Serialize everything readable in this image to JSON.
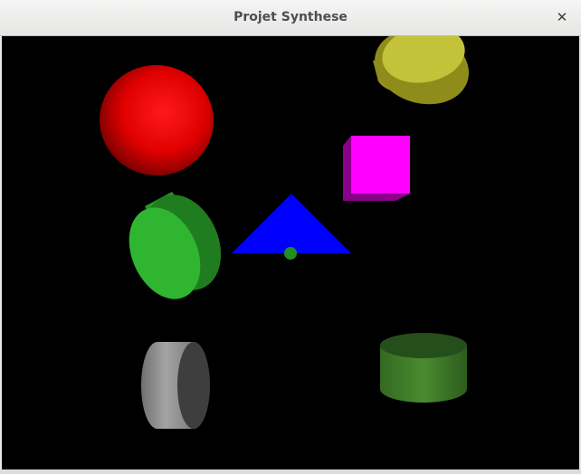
{
  "window": {
    "title": "Projet Synthese",
    "close_glyph": "✕",
    "close_icon": "close-icon"
  },
  "scene": {
    "background": "#000000",
    "objects": [
      {
        "name": "red-sphere",
        "shape": "sphere",
        "color": "#ff0000"
      },
      {
        "name": "yellow-cylinder",
        "shape": "cylinder",
        "color": "#c8c832"
      },
      {
        "name": "magenta-cube",
        "shape": "cube",
        "color": "#ff00ff"
      },
      {
        "name": "green-cylinder",
        "shape": "cylinder",
        "color": "#2db82d"
      },
      {
        "name": "blue-triangle",
        "shape": "triangle",
        "color": "#0000ff"
      },
      {
        "name": "green-dot",
        "shape": "sphere",
        "color": "#1f8f1f"
      },
      {
        "name": "gray-cylinder",
        "shape": "cylinder",
        "color": "#8a8a8a"
      },
      {
        "name": "dark-green-cylinder",
        "shape": "cylinder",
        "color": "#3c7a28"
      }
    ]
  }
}
